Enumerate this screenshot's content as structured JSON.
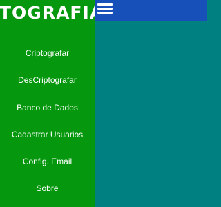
{
  "sidebar": {
    "title": "TOGRAFIA",
    "items": [
      {
        "label": "Criptografar"
      },
      {
        "label": "DesCriptografar"
      },
      {
        "label": "Banco de Dados"
      },
      {
        "label": "Cadastrar Usuarios"
      },
      {
        "label": "Config. Email"
      },
      {
        "label": "Sobre"
      }
    ]
  },
  "topbar": {
    "menu_icon": "hamburger-menu-icon"
  },
  "colors": {
    "sidebar_bg": "#05970d",
    "topbar_bg": "#1650b8",
    "content_bg": "#008080",
    "text": "#ffffff"
  }
}
